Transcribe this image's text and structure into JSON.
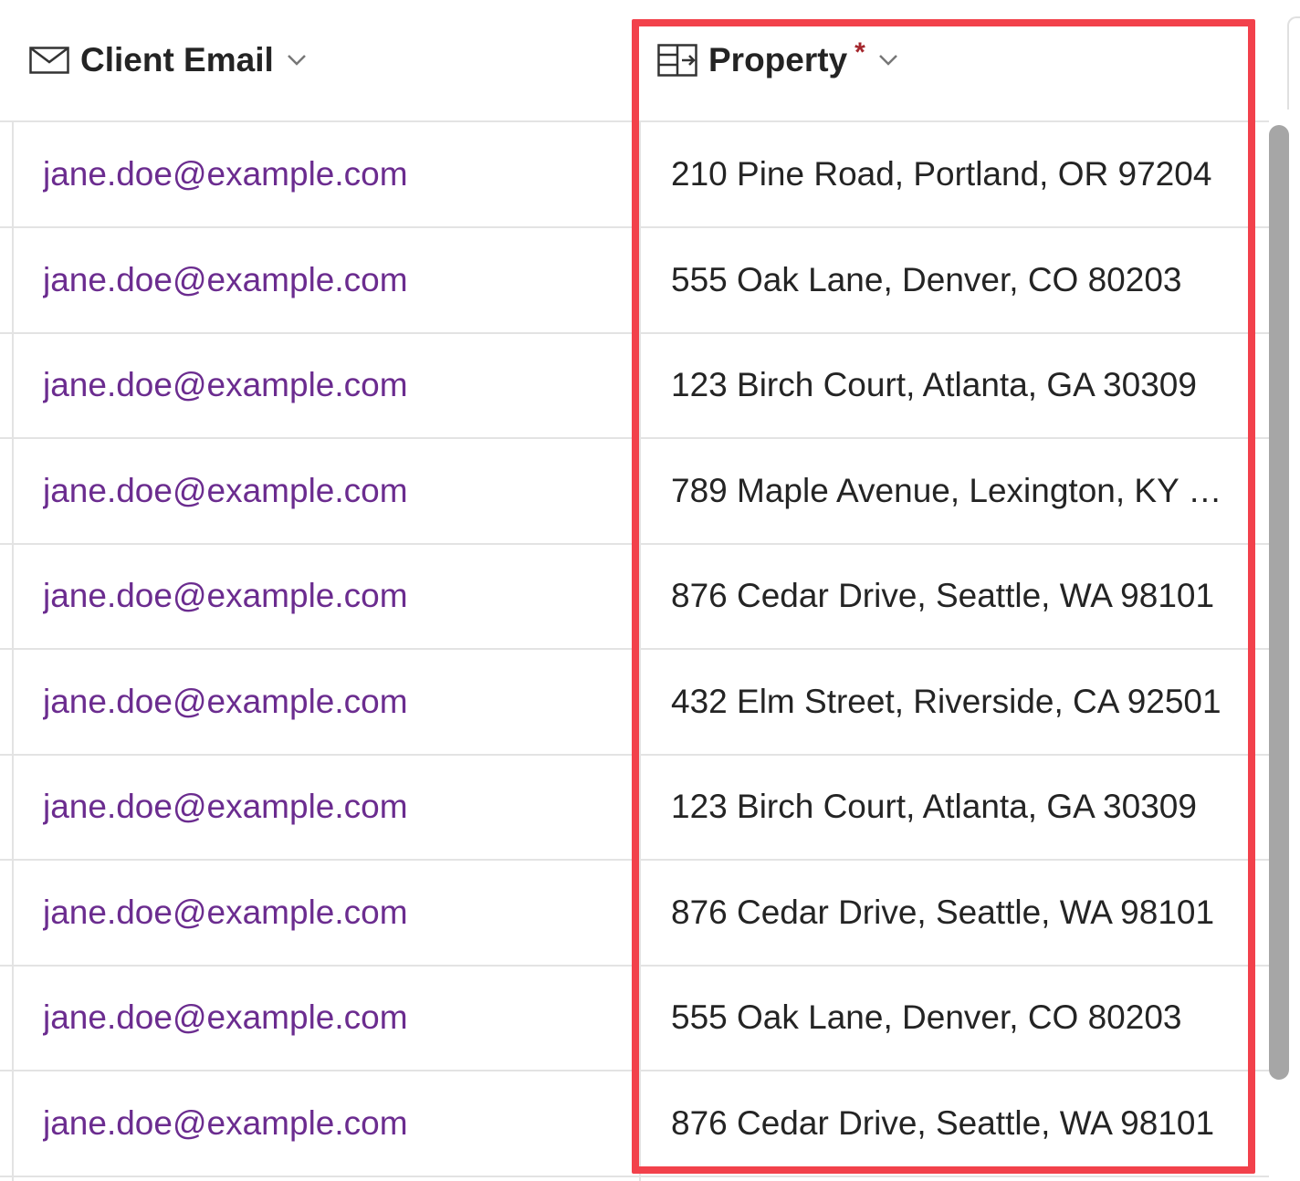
{
  "columns": {
    "email": {
      "label": "Client Email",
      "icon": "mail-icon"
    },
    "property": {
      "label": "Property",
      "required_marker": "*",
      "icon": "property-table-icon"
    }
  },
  "rows": [
    {
      "email": "jane.doe@example.com",
      "property": "210 Pine Road, Portland, OR 97204"
    },
    {
      "email": "jane.doe@example.com",
      "property": "555 Oak Lane, Denver, CO 80203"
    },
    {
      "email": "jane.doe@example.com",
      "property": "123 Birch Court, Atlanta, GA 30309"
    },
    {
      "email": "jane.doe@example.com",
      "property": "789 Maple Avenue, Lexington, KY …"
    },
    {
      "email": "jane.doe@example.com",
      "property": "876 Cedar Drive, Seattle, WA 98101"
    },
    {
      "email": "jane.doe@example.com",
      "property": "432 Elm Street, Riverside, CA 92501"
    },
    {
      "email": "jane.doe@example.com",
      "property": "123 Birch Court, Atlanta, GA 30309"
    },
    {
      "email": "jane.doe@example.com",
      "property": "876 Cedar Drive, Seattle, WA 98101"
    },
    {
      "email": "jane.doe@example.com",
      "property": "555 Oak Lane, Denver, CO 80203"
    },
    {
      "email": "jane.doe@example.com",
      "property": "876 Cedar Drive, Seattle, WA 98101"
    }
  ],
  "colors": {
    "link": "#6b2c8f",
    "highlight": "#f2414b",
    "required": "#a4262c"
  }
}
